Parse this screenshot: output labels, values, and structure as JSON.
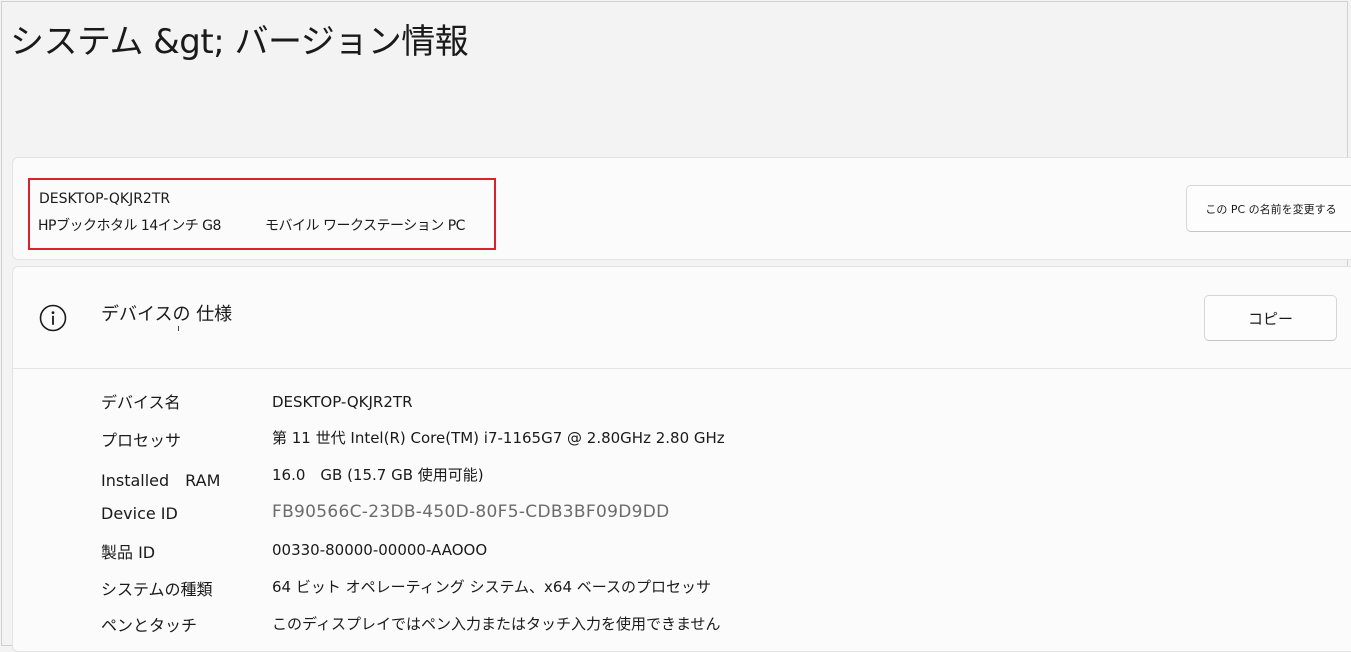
{
  "header": {
    "title": "システム &gt;  バージョン情報"
  },
  "device": {
    "name": "DESKTOP-QKJR2TR",
    "model": "HPブックホタル 14インチ G8",
    "type": "モバイル ワークステーション PC",
    "rename_button": "この PC の名前を変更する"
  },
  "specs": {
    "section_title": "デバイスの 仕様",
    "copy_button": "コピー",
    "icon": "info-icon",
    "rows": [
      {
        "label": "デバイス名",
        "value": "DESKTOP-QKJR2TR"
      },
      {
        "label": "プロセッサ",
        "value": "第 11 世代 Intel(R) Core(TM) i7-1165G7 @ 2.80GHz 2.80 GHz"
      },
      {
        "label": "Installed　RAM",
        "value": "16.0　GB (15.7 GB 使用可能)"
      },
      {
        "label": "Device ID",
        "value": "FB90566C-23DB-450D-80F5-CDB3BF09D9DD"
      },
      {
        "label": "製品 ID",
        "value": "00330-80000-00000-AAOOO"
      },
      {
        "label": "システムの種類",
        "value": "64 ビット オペレーティング システム、x64 ベースのプロセッサ"
      },
      {
        "label": "ペンとタッチ",
        "value": "このディスプレイではペン入力またはタッチ入力を使用できません"
      }
    ]
  },
  "colors": {
    "highlight": "#d9232a",
    "background": "#f3f3f3",
    "card": "#fbfbfb"
  }
}
